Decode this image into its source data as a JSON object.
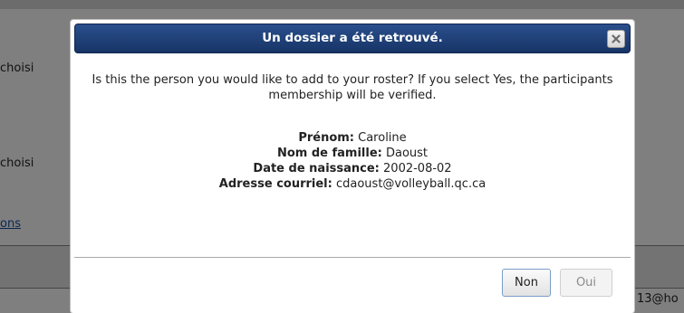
{
  "background": {
    "text_1": "choisi",
    "text_2": "choisi",
    "link": "ons",
    "email_partial": "13@ho"
  },
  "dialog": {
    "title": "Un dossier a été retrouvé.",
    "question": "Is this the person you would like to add to your roster? If you select Yes, the participants membership will be verified.",
    "fields": [
      {
        "label": "Prénom:",
        "value": "Caroline"
      },
      {
        "label": "Nom de famille:",
        "value": "Daoust"
      },
      {
        "label": "Date de naissance:",
        "value": "2002-08-02"
      },
      {
        "label": "Adresse courriel:",
        "value": "cdaoust@volleyball.qc.ca"
      }
    ],
    "buttons": {
      "non": "Non",
      "oui": "Oui"
    }
  },
  "icons": {
    "close": "close-icon"
  },
  "colors": {
    "titlebar": "#173467",
    "overlay": "rgba(0,0,0,0.5)"
  }
}
